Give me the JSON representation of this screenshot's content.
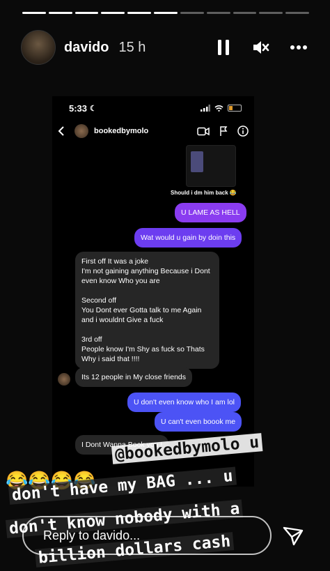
{
  "story": {
    "username": "davido",
    "time_ago": "15 h",
    "progress_total": 11,
    "progress_done": 6
  },
  "icons": {
    "pause": "pause-icon",
    "mute": "mute-icon",
    "more": "more-icon",
    "send": "send-icon"
  },
  "screenshot": {
    "status_time": "5:33",
    "dm_username": "bookedbymolo",
    "caption": "Should i dm him back 😂",
    "messages": [
      {
        "side": "right",
        "text": "U LAME AS HELL"
      },
      {
        "side": "right",
        "text": "Wat would u gain by doin this"
      },
      {
        "side": "left",
        "text": "First off It was a joke\nI'm not gaining anything Because i Dont even know Who you are\n\nSecond off\nYou Dont ever Gotta talk to me Again and i wouldnt Give a fuck\n\n3rd off\nPeople know I'm Shy as fuck so Thats Why i said that !!!!"
      },
      {
        "side": "left",
        "text": "Its 12 people in My close friends"
      },
      {
        "side": "right",
        "text": "U don't even know who I am lol"
      },
      {
        "side": "right",
        "text": "U can't even boook me"
      },
      {
        "side": "left",
        "text": "I Dont Wanna Book you !"
      }
    ]
  },
  "overlay": {
    "emojis": "😂😂😂😂",
    "line1": "@bookedbymolo u",
    "line2": "don't have my BAG ... u",
    "line3": "don't know nobody with a",
    "line4": "billion dollars cash"
  },
  "reply": {
    "placeholder": "Reply to davido..."
  },
  "colors": {
    "purple_bubble": "#8a3cf0",
    "blue_bubble": "#4c53f5",
    "gray_bubble": "#262626"
  }
}
